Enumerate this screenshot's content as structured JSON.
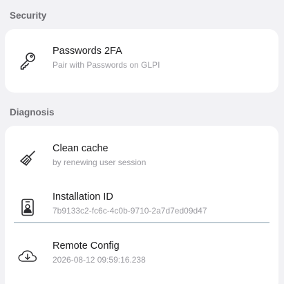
{
  "sections": {
    "security": {
      "title": "Security",
      "items": [
        {
          "title": "Passwords 2FA",
          "subtitle": "Pair with Passwords on GLPI",
          "icon": "key-icon"
        }
      ]
    },
    "diagnosis": {
      "title": "Diagnosis",
      "items": [
        {
          "title": "Clean cache",
          "subtitle": "by renewing user session",
          "icon": "broom-icon"
        },
        {
          "title": "Installation ID",
          "subtitle": "7b9133c2-fc6c-4c0b-9710-2a7d7ed09d47",
          "icon": "id-badge-icon"
        },
        {
          "title": "Remote Config",
          "subtitle": "2026-08-12 09:59:16.238",
          "icon": "cloud-download-icon"
        }
      ]
    }
  }
}
